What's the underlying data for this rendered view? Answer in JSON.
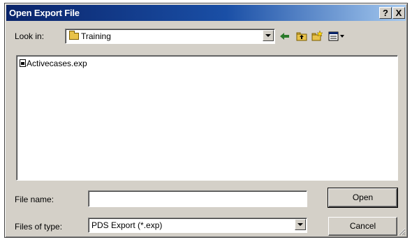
{
  "window": {
    "title": "Open Export File",
    "help_label": "?",
    "close_label": "X"
  },
  "look_in": {
    "label": "Look in:",
    "value": "Training",
    "icon": "folder-icon"
  },
  "toolbar": {
    "icons": [
      "back-arrow-icon",
      "up-folder-icon",
      "new-folder-icon",
      "view-menu-icon"
    ]
  },
  "files": [
    {
      "name": "Activecases.exp",
      "icon": "document-icon"
    }
  ],
  "file_name": {
    "label": "File name:",
    "value": ""
  },
  "file_type": {
    "label": "Files of type:",
    "value": "PDS Export (*.exp)"
  },
  "buttons": {
    "open": "Open",
    "cancel": "Cancel"
  },
  "colors": {
    "dialog_face": "#d4d0c8",
    "title_start": "#0a246a",
    "title_end": "#a6caf0"
  }
}
